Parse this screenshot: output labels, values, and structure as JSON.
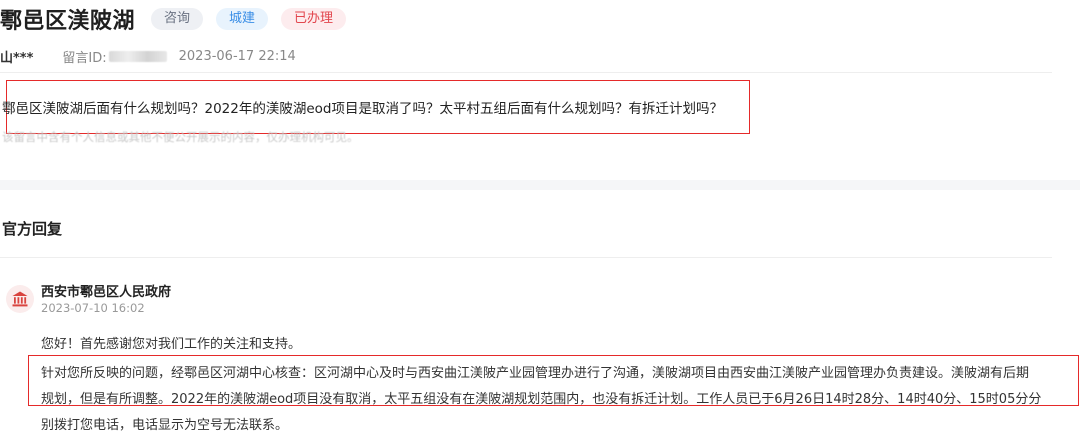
{
  "header": {
    "title": "鄠邑区渼陂湖",
    "tags": {
      "consult": "咨询",
      "city": "城建",
      "done": "已办理"
    }
  },
  "meta": {
    "user": "山***",
    "id_label": "留言ID:",
    "time": "2023-06-17 22:14"
  },
  "question": {
    "text": "鄠邑区渼陂湖后面有什么规划吗？2022年的渼陂湖eod项目是取消了吗？太平村五组后面有什么规划吗？有拆迁计划吗？",
    "note": "该留言中含有个人信息或其他不便公开展示的内容，仅办理机构可见。"
  },
  "official": {
    "section_title": "官方回复",
    "department": "西安市鄠邑区人民政府",
    "time": "2023-07-10 16:02",
    "lines": [
      "您好！首先感谢您对我们工作的关注和支持。",
      "针对您所反映的问题，经鄠邑区河湖中心核查：区河湖中心及时与西安曲江渼陂产业园管理办进行了沟通，渼陂湖项目由西安曲江渼陂产业园管理办负责建设。渼陂湖有后期",
      "规划，但是有所调整。2022年的渼陂湖eod项目没有取消，太平五组没有在渼陂湖规划范围内，也没有拆迁计划。工作人员已于6月26日14时28分、14时40分、15时05分分",
      "别拨打您电话，电话显示为空号无法联系。"
    ]
  },
  "colors": {
    "highlight_border": "#e52a2a",
    "tag_city": "#3a8ee6",
    "tag_done": "#e2464e",
    "gov_icon": "#d9443f"
  },
  "icons": {
    "avatar": "government-building-icon"
  }
}
